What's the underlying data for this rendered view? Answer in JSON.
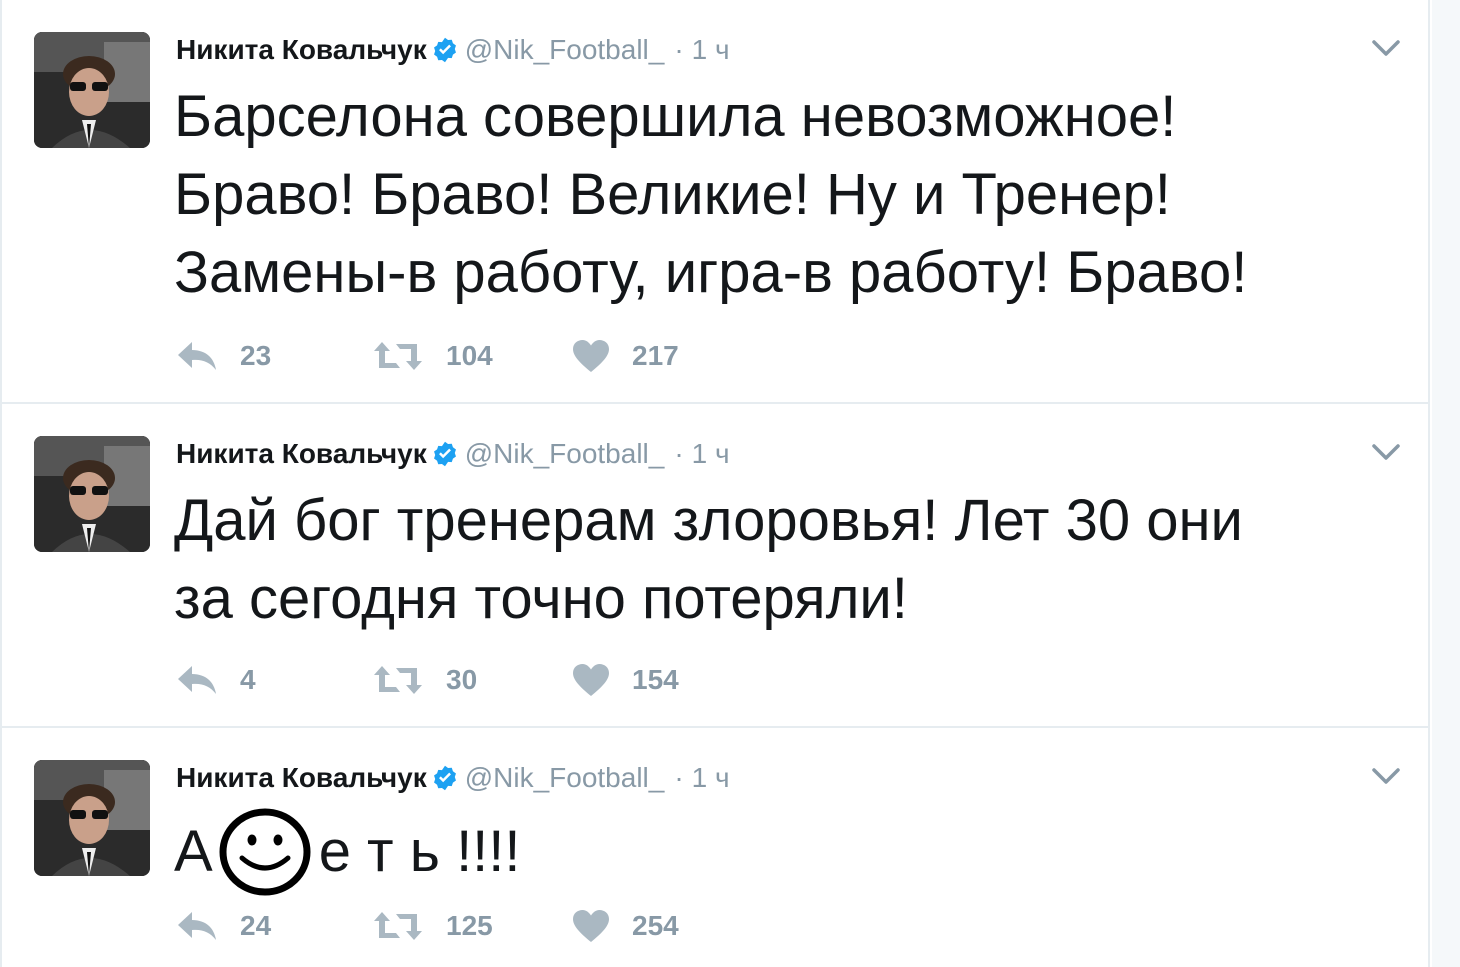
{
  "colors": {
    "verified": "#1da1f2",
    "meta_gray": "#8899a6",
    "text": "#14171a",
    "divider": "#e6ecf0"
  },
  "tweets": [
    {
      "author_name": "Никита Ковальчук",
      "handle": "@Nik_Football_",
      "separator": "·",
      "time": "1 ч",
      "text_lines": [
        "Барселона совершила невозможное!",
        "Браво! Браво! Великие! Ну и Тренер!",
        "Замены-в работу, игра-в работу! Браво!"
      ],
      "replies": "23",
      "retweets": "104",
      "likes": "217"
    },
    {
      "author_name": "Никита Ковальчук",
      "handle": "@Nik_Football_",
      "separator": "·",
      "time": "1 ч",
      "text_lines": [
        "Дай бог тренерам злоровья! Лет 30 они",
        "за сегодня точно потеряли!"
      ],
      "replies": "4",
      "retweets": "30",
      "likes": "154"
    },
    {
      "author_name": "Никита Ковальчук",
      "handle": "@Nik_Football_",
      "separator": "·",
      "time": "1 ч",
      "text_prefix": "А",
      "text_suffix": "е т ь !!!!",
      "replies": "24",
      "retweets": "125",
      "likes": "254"
    }
  ],
  "icons": [
    "avatar-photo",
    "verified-badge-icon",
    "caret-down-icon",
    "reply-icon",
    "retweet-icon",
    "heart-icon",
    "smiley-face-icon"
  ]
}
